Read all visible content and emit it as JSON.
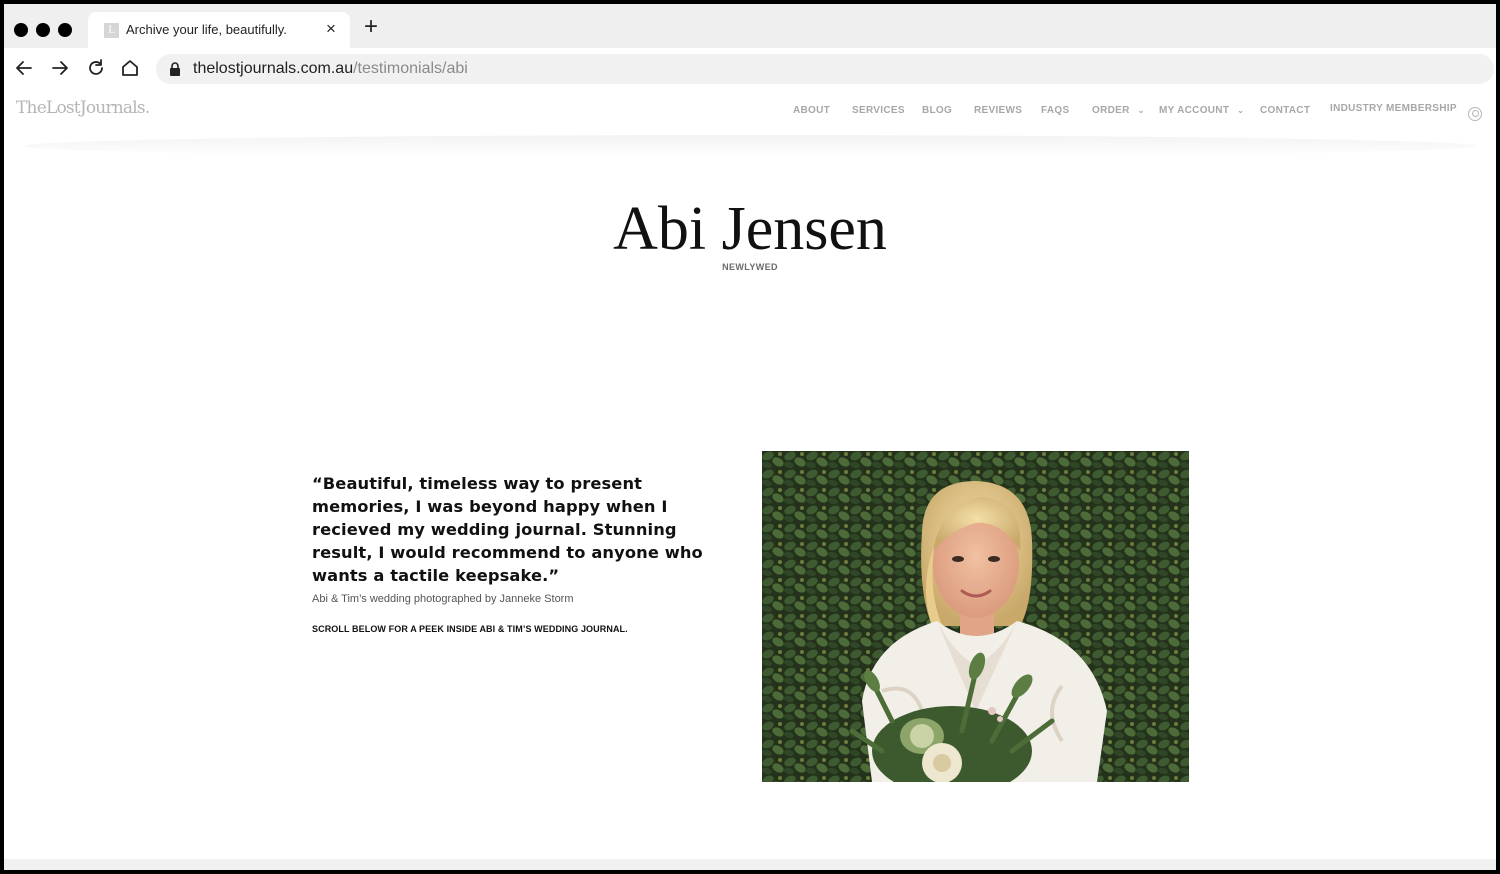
{
  "browser": {
    "tab_title": "Archive your life, beautifully.",
    "tab_close": "×",
    "new_tab": "+",
    "favicon_letter": "L",
    "url_host": "thelostjournals.com.au",
    "url_path": "/testimonials/abi"
  },
  "site": {
    "logo_the": "The",
    "logo_lost": "Lost",
    "logo_journals": "Journals."
  },
  "nav": {
    "about": "ABOUT",
    "services": "SERVICES",
    "blog": "BLOG",
    "reviews": "REVIEWS",
    "faqs": "FAQS",
    "order": "ORDER",
    "my_account": "MY ACCOUNT",
    "contact": "CONTACT",
    "industry_membership": "INDUSTRY MEMBERSHIP",
    "caret": "⌄"
  },
  "hero": {
    "name": "Abi Jensen",
    "tag": "NEWLYWED"
  },
  "testimonial": {
    "quote": "“Beautiful, timeless way to present memories, I was beyond happy when I recieved my wedding journal. Stunning result, I would recommend to anyone who wants a tactile keepsake.”",
    "credit": "Abi & Tim’s wedding photographed by Janneke Storm",
    "cta": "SCROLL BELOW FOR A PEEK INSIDE ABI & TIM’S WEDDING JOURNAL."
  },
  "colors": {
    "nav_text": "#a7a7a7",
    "heading": "#111111",
    "foliage": "#2f4226",
    "fur_wrap": "#f2efe8"
  },
  "icons": {
    "back": "back-arrow-icon",
    "forward": "forward-arrow-icon",
    "reload": "reload-icon",
    "home": "home-icon",
    "lock": "lock-icon",
    "account": "user-account-icon"
  }
}
